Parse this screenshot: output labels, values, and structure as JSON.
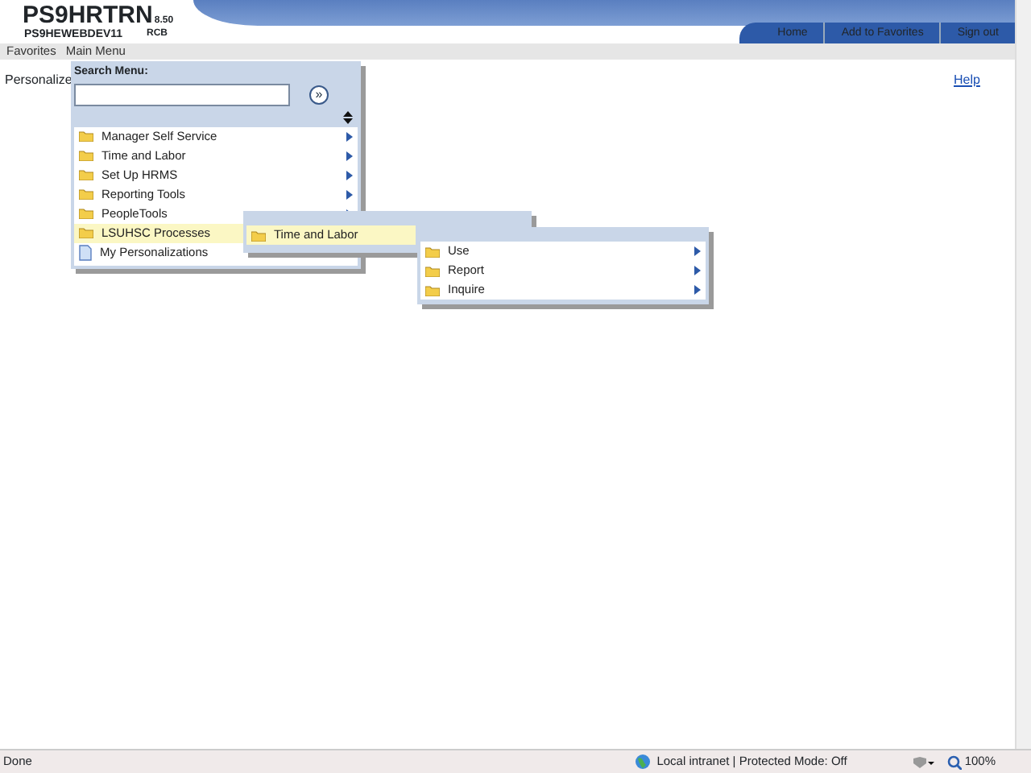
{
  "header": {
    "title": "PS9HRTRN",
    "version": "8.50",
    "server": "PS9HEWEBDEV11",
    "user": "RCB"
  },
  "nav_links": [
    "Home",
    "Add to Favorites",
    "Sign out"
  ],
  "menubar": [
    {
      "label": "Favorites"
    },
    {
      "label": "Main Menu"
    }
  ],
  "page": {
    "text": "Personalize",
    "help": "Help"
  },
  "main_menu": {
    "search_label": "Search Menu:",
    "go_button": "»",
    "items": [
      {
        "label": "Manager Self Service",
        "kind": "folder",
        "submenu": true,
        "selected": false
      },
      {
        "label": "Time and Labor",
        "kind": "folder",
        "submenu": true,
        "selected": false
      },
      {
        "label": "Set Up HRMS",
        "kind": "folder",
        "submenu": true,
        "selected": false
      },
      {
        "label": "Reporting Tools",
        "kind": "folder",
        "submenu": true,
        "selected": false
      },
      {
        "label": "PeopleTools",
        "kind": "folder",
        "submenu": true,
        "selected": false
      },
      {
        "label": "LSUHSC Processes",
        "kind": "folder",
        "selected": true
      },
      {
        "label": "My Personalizations",
        "kind": "page",
        "selected": false
      }
    ]
  },
  "submenu_1": {
    "items": [
      {
        "label": "Time and Labor",
        "kind": "folder",
        "selected": true
      }
    ]
  },
  "submenu_2": {
    "items": [
      {
        "label": "Use",
        "kind": "folder",
        "submenu": true,
        "selected": false
      },
      {
        "label": "Report",
        "kind": "folder",
        "submenu": true,
        "selected": false
      },
      {
        "label": "Inquire",
        "kind": "folder",
        "submenu": true,
        "selected": false
      }
    ]
  },
  "status_bar": {
    "text": "Done",
    "zone": "Local intranet | Protected Mode: Off",
    "zoom": "100%"
  }
}
